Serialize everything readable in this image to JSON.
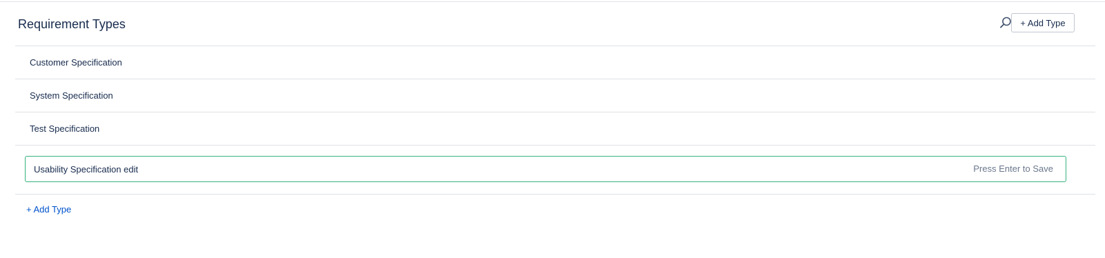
{
  "header": {
    "title": "Requirement Types",
    "search_icon": "search-icon",
    "add_type_label": "+ Add Type"
  },
  "types": [
    {
      "label": "Customer Specification"
    },
    {
      "label": "System Specification"
    },
    {
      "label": "Test Specification"
    }
  ],
  "editor": {
    "value": "Usability Specification edit",
    "hint": "Press Enter to Save",
    "border_color": "#36b37e"
  },
  "footer": {
    "add_type_link_label": "+ Add Type",
    "link_color": "#0052cc"
  }
}
